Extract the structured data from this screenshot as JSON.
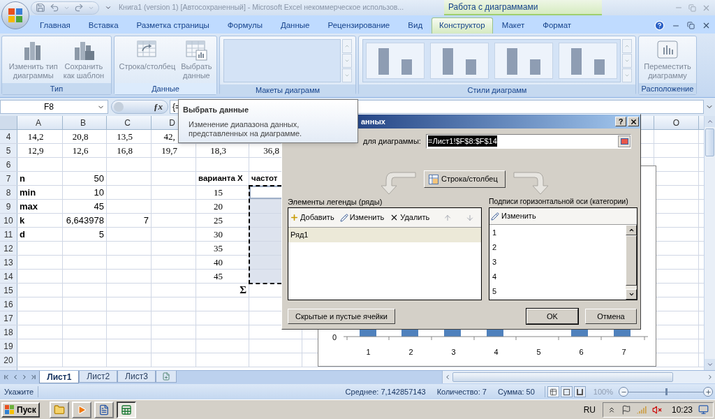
{
  "title_bar": {
    "title": "Книга1 (version 1) [Автосохраненный] - Microsoft Excel некоммерческое использов...",
    "context_title": "Работа с диаграммами"
  },
  "tabs": [
    {
      "label": "Главная",
      "selected": false
    },
    {
      "label": "Вставка",
      "selected": false
    },
    {
      "label": "Разметка страницы",
      "selected": false
    },
    {
      "label": "Формулы",
      "selected": false
    },
    {
      "label": "Данные",
      "selected": false
    },
    {
      "label": "Рецензирование",
      "selected": false
    },
    {
      "label": "Вид",
      "selected": false
    },
    {
      "label": "Конструктор",
      "selected": true
    },
    {
      "label": "Макет",
      "selected": false
    },
    {
      "label": "Формат",
      "selected": false
    }
  ],
  "ribbon": [
    {
      "label": "Тип",
      "kind": "buttons",
      "highlighted": false,
      "buttons": [
        {
          "label": "Изменить тип\nдиаграммы",
          "disabled": true
        },
        {
          "label": "Сохранить\nкак шаблон",
          "disabled": true
        }
      ]
    },
    {
      "label": "Данные",
      "kind": "buttons",
      "highlighted": true,
      "buttons": [
        {
          "label": "Строка/столбец",
          "disabled": true
        },
        {
          "label": "Выбрать\nданные",
          "disabled": true
        }
      ]
    },
    {
      "label": "Макеты диаграмм",
      "kind": "layout-gallery",
      "highlighted": false
    },
    {
      "label": "Стили диаграмм",
      "kind": "style-gallery",
      "highlighted": false
    },
    {
      "label": "Расположение",
      "kind": "buttons",
      "highlighted": false,
      "buttons": [
        {
          "label": "Переместить\nдиаграмму",
          "disabled": true
        }
      ]
    }
  ],
  "formula_bar": {
    "name_box": "F8",
    "function_button": "ƒx",
    "formula": "{="
  },
  "sheet": {
    "columns": [
      "A",
      "B",
      "C",
      "D"
    ],
    "right_column": "O",
    "rows": [
      {
        "number": "4",
        "cells": {
          "A": {
            "kind": "serif",
            "text": "14,2"
          },
          "B": {
            "kind": "serif",
            "text": "20,8"
          },
          "C": {
            "kind": "serif",
            "text": "13,5"
          },
          "D": {
            "kind": "serif",
            "text": "42,"
          }
        }
      },
      {
        "number": "5",
        "cells": {
          "A": {
            "kind": "serif",
            "text": "12,9"
          },
          "B": {
            "kind": "serif",
            "text": "12,6"
          },
          "C": {
            "kind": "serif",
            "text": "16,8"
          },
          "D": {
            "kind": "serif",
            "text": "19,7"
          },
          "E": {
            "kind": "serif",
            "text": "18,3"
          },
          "F": {
            "kind": "serif",
            "text": "36,8"
          }
        }
      },
      {
        "number": "6"
      },
      {
        "number": "7",
        "cells": {
          "A": {
            "kind": "label",
            "text": "n"
          },
          "B": {
            "kind": "number",
            "text": "50"
          },
          "E": {
            "kind": "heading",
            "text": "варианта X"
          },
          "F": {
            "kind": "heading",
            "text": "частот"
          }
        }
      },
      {
        "number": "8",
        "cells": {
          "A": {
            "kind": "label",
            "text": "min"
          },
          "B": {
            "kind": "number",
            "text": "10"
          },
          "E": {
            "kind": "serif",
            "text": "15"
          },
          "F": {
            "selected": true,
            "active": true
          }
        }
      },
      {
        "number": "9",
        "cells": {
          "A": {
            "kind": "label",
            "text": "max"
          },
          "B": {
            "kind": "number",
            "text": "45"
          },
          "E": {
            "kind": "serif",
            "text": "20"
          },
          "F": {
            "selected": true,
            "active": false
          }
        }
      },
      {
        "number": "10",
        "cells": {
          "A": {
            "kind": "label",
            "text": "k"
          },
          "B": {
            "kind": "number",
            "text": "6,643978"
          },
          "C": {
            "kind": "number",
            "text": "7"
          },
          "E": {
            "kind": "serif",
            "text": "25"
          },
          "F": {
            "selected": true,
            "active": false
          }
        }
      },
      {
        "number": "11",
        "cells": {
          "A": {
            "kind": "label",
            "text": "d"
          },
          "B": {
            "kind": "number",
            "text": "5"
          },
          "E": {
            "kind": "serif",
            "text": "30"
          },
          "F": {
            "selected": true,
            "active": false
          }
        }
      },
      {
        "number": "12",
        "cells": {
          "E": {
            "kind": "serif",
            "text": "35"
          },
          "F": {
            "selected": true,
            "active": false
          }
        }
      },
      {
        "number": "13",
        "cells": {
          "E": {
            "kind": "serif",
            "text": "40"
          },
          "F": {
            "selected": true,
            "active": false
          }
        }
      },
      {
        "number": "14",
        "cells": {
          "E": {
            "kind": "serif",
            "text": "45"
          },
          "F": {
            "selected": true,
            "active": false
          }
        }
      },
      {
        "number": "15",
        "cells": {
          "E": {
            "kind": "sum",
            "text": "Σ"
          }
        }
      },
      {
        "number": "16"
      },
      {
        "number": "17"
      },
      {
        "number": "18"
      },
      {
        "number": "19"
      },
      {
        "number": "20"
      }
    ]
  },
  "chart": {
    "y_tick": "0",
    "categories": [
      "1",
      "2",
      "3",
      "4",
      "5",
      "6",
      "7"
    ]
  },
  "tooltip": {
    "title": "Выбрать данные",
    "description": "Изменение диапазона данных,\nпредставленных на диаграмме."
  },
  "dialog": {
    "title": "анных",
    "help_button": "?",
    "range_label": "для диаграммы:",
    "range_value": "=Лист1!$F$8:$F$14",
    "switch_button": "Строка/столбец",
    "series_panel": {
      "label": "Элементы легенды (ряды)",
      "actions": [
        "Добавить",
        "Изменить",
        "Удалить"
      ],
      "items": [
        {
          "label": "Ряд1",
          "selected": true
        }
      ]
    },
    "axis_panel": {
      "label": "Подписи горизонтальной оси (категории)",
      "action": "Изменить",
      "items": [
        "1",
        "2",
        "3",
        "4",
        "5"
      ]
    },
    "hidden_cells_button": "Скрытые и пустые ячейки",
    "ok_button": "OK",
    "cancel_button": "Отмена"
  },
  "sheet_tabs": [
    {
      "label": "Лист1",
      "selected": true
    },
    {
      "label": "Лист2",
      "selected": false
    },
    {
      "label": "Лист3",
      "selected": false
    }
  ],
  "status_bar": {
    "mode": "Укажите",
    "average": "Среднее: 7,142857143",
    "count": "Количество: 7",
    "sum": "Сумма: 50",
    "zoom": "100%",
    "zoom_slider": {
      "level": 0.5
    }
  },
  "taskbar": {
    "start": "Пуск",
    "apps": [
      {
        "selected": false
      },
      {
        "selected": false
      },
      {
        "selected": false
      },
      {
        "selected": true
      }
    ],
    "language": "RU",
    "clock": "10:23"
  }
}
